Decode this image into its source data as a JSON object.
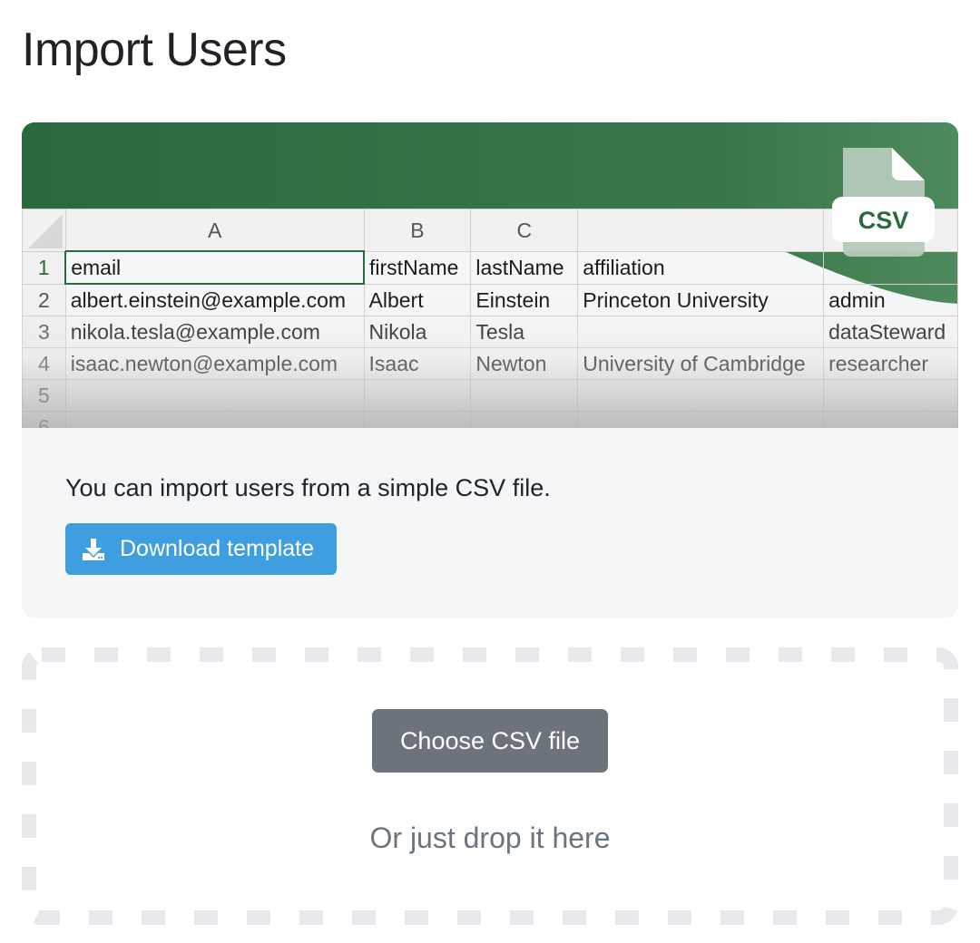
{
  "page": {
    "title": "Import Users"
  },
  "illustration": {
    "csv_badge": "CSV",
    "column_headers": [
      "A",
      "B",
      "C",
      "",
      ""
    ],
    "row_numbers": [
      "1",
      "2",
      "3",
      "4",
      "5",
      "6"
    ],
    "rows": [
      [
        "email",
        "firstName",
        "lastName",
        "affiliation",
        ""
      ],
      [
        "albert.einstein@example.com",
        "Albert",
        "Einstein",
        "Princeton University",
        "admin"
      ],
      [
        "nikola.tesla@example.com",
        "Nikola",
        "Tesla",
        "",
        "dataSteward"
      ],
      [
        "isaac.newton@example.com",
        "Isaac",
        "Newton",
        "University of Cambridge",
        "researcher"
      ],
      [
        "",
        "",
        "",
        "",
        ""
      ],
      [
        "",
        "",
        "",
        "",
        ""
      ]
    ]
  },
  "info": {
    "text": "You can import users from a simple CSV file.",
    "download_label": "Download template"
  },
  "dropzone": {
    "choose_label": "Choose CSV file",
    "drop_text": "Or just drop it here"
  },
  "colors": {
    "brand_green": "#2b6a3e",
    "download_button": "#3e9ee0",
    "choose_button": "#6c737b",
    "card_background": "#f5f6f8",
    "dashed_border": "#e8e9ed"
  },
  "icons": [
    "download-icon",
    "csv-file-icon"
  ]
}
